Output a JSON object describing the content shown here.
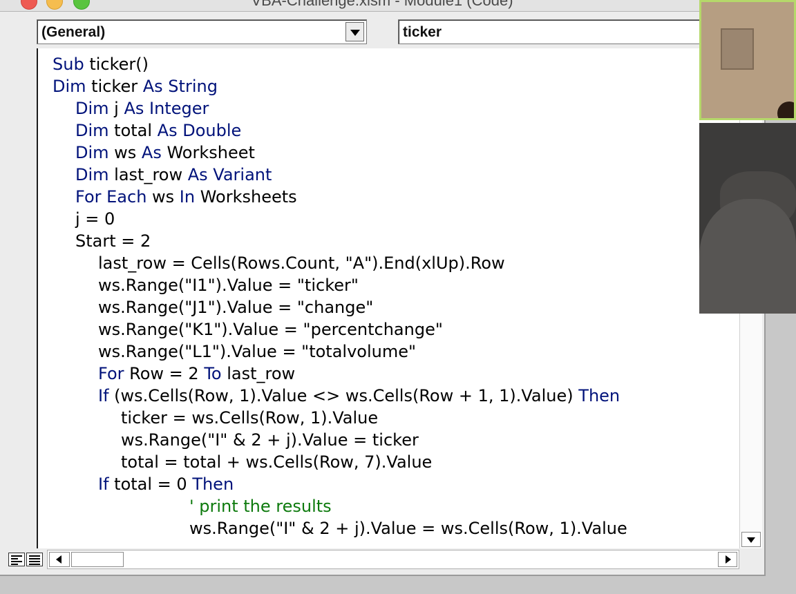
{
  "window": {
    "title": "VBA-Challenge.xlsm - Module1 (Code)"
  },
  "object_combo": {
    "value": "(General)"
  },
  "procedure_combo": {
    "value": "ticker"
  },
  "code_lines": [
    {
      "indent": 0,
      "tokens": [
        {
          "t": "Sub",
          "k": "kw"
        },
        {
          "t": " ticker()"
        }
      ]
    },
    {
      "indent": 0,
      "tokens": [
        {
          "t": "Dim",
          "k": "kw"
        },
        {
          "t": " ticker "
        },
        {
          "t": "As String",
          "k": "kw"
        }
      ]
    },
    {
      "indent": 1,
      "tokens": [
        {
          "t": "Dim",
          "k": "kw"
        },
        {
          "t": " j "
        },
        {
          "t": "As Integer",
          "k": "kw"
        }
      ]
    },
    {
      "indent": 1,
      "tokens": [
        {
          "t": "Dim",
          "k": "kw"
        },
        {
          "t": " total "
        },
        {
          "t": "As Double",
          "k": "kw"
        }
      ]
    },
    {
      "indent": 1,
      "tokens": [
        {
          "t": "Dim",
          "k": "kw"
        },
        {
          "t": " ws "
        },
        {
          "t": "As",
          "k": "kw"
        },
        {
          "t": " Worksheet"
        }
      ]
    },
    {
      "indent": 1,
      "tokens": [
        {
          "t": "Dim",
          "k": "kw"
        },
        {
          "t": " last_row "
        },
        {
          "t": "As Variant",
          "k": "kw"
        }
      ]
    },
    {
      "indent": 1,
      "tokens": [
        {
          "t": "For Each",
          "k": "kw"
        },
        {
          "t": " ws "
        },
        {
          "t": "In",
          "k": "kw"
        },
        {
          "t": " Worksheets"
        }
      ]
    },
    {
      "indent": 1,
      "tokens": [
        {
          "t": "j = 0"
        }
      ]
    },
    {
      "indent": 1,
      "tokens": [
        {
          "t": "Start = 2"
        }
      ]
    },
    {
      "indent": 2,
      "tokens": [
        {
          "t": "last_row = Cells(Rows.Count, \"A\").End(xlUp).Row"
        }
      ]
    },
    {
      "indent": 2,
      "tokens": [
        {
          "t": "ws.Range(\"I1\").Value = \"ticker\""
        }
      ]
    },
    {
      "indent": 2,
      "tokens": [
        {
          "t": "ws.Range(\"J1\").Value = \"change\""
        }
      ]
    },
    {
      "indent": 2,
      "tokens": [
        {
          "t": "ws.Range(\"K1\").Value = \"percentchange\""
        }
      ]
    },
    {
      "indent": 2,
      "tokens": [
        {
          "t": "ws.Range(\"L1\").Value = \"totalvolume\""
        }
      ]
    },
    {
      "indent": 2,
      "tokens": [
        {
          "t": "For",
          "k": "kw"
        },
        {
          "t": " Row = 2 "
        },
        {
          "t": "To",
          "k": "kw"
        },
        {
          "t": " last_row"
        }
      ]
    },
    {
      "indent": 2,
      "tokens": [
        {
          "t": "If",
          "k": "kw"
        },
        {
          "t": " (ws.Cells(Row, 1).Value <> ws.Cells(Row + 1, 1).Value) "
        },
        {
          "t": "Then",
          "k": "kw"
        }
      ]
    },
    {
      "indent": 3,
      "tokens": [
        {
          "t": "ticker = ws.Cells(Row, 1).Value"
        }
      ]
    },
    {
      "indent": 3,
      "tokens": [
        {
          "t": "ws.Range(\"I\" & 2 + j).Value = ticker"
        }
      ]
    },
    {
      "indent": 3,
      "tokens": [
        {
          "t": "total = total + ws.Cells(Row, 7).Value"
        }
      ]
    },
    {
      "indent": 2,
      "tokens": [
        {
          "t": "If",
          "k": "kw"
        },
        {
          "t": " total = 0 "
        },
        {
          "t": "Then",
          "k": "kw"
        }
      ]
    },
    {
      "indent": 6,
      "tokens": [
        {
          "t": "' print the results",
          "k": "cm"
        }
      ]
    },
    {
      "indent": 6,
      "tokens": [
        {
          "t": "ws.Range(\"I\" & 2 + j).Value = ws.Cells(Row, 1).Value"
        }
      ]
    }
  ],
  "colors": {
    "keyword": "#00127a",
    "comment": "#0d7a0d",
    "text": "#000000"
  }
}
